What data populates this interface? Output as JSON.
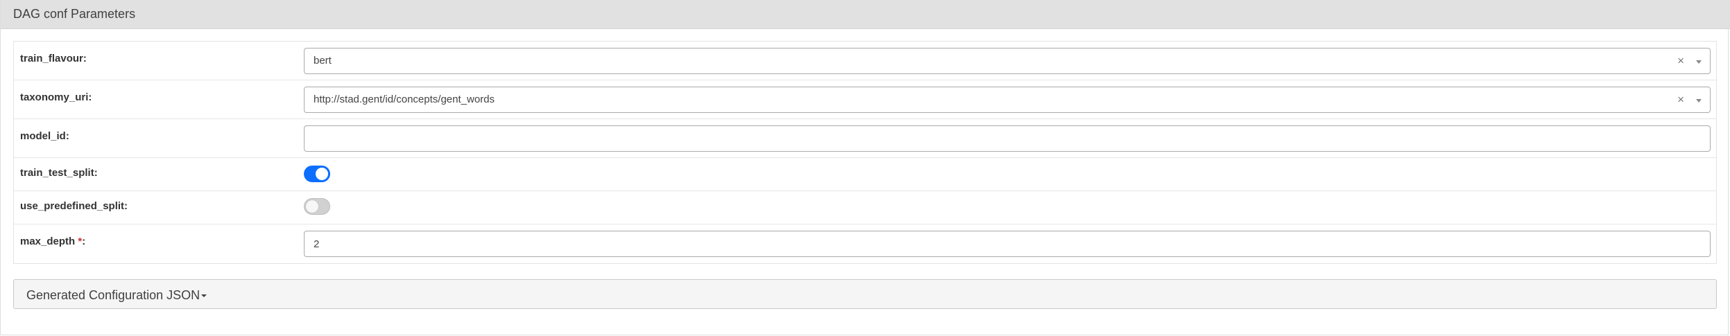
{
  "panel": {
    "title": "DAG conf Parameters"
  },
  "params": {
    "train_flavour": {
      "label": "train_flavour:",
      "value": "bert",
      "clear_glyph": "×"
    },
    "taxonomy_uri": {
      "label": "taxonomy_uri:",
      "value": "http://stad.gent/id/concepts/gent_words",
      "clear_glyph": "×"
    },
    "model_id": {
      "label": "model_id:",
      "value": ""
    },
    "train_test_split": {
      "label": "train_test_split:",
      "checked": true
    },
    "use_predefined_split": {
      "label": "use_predefined_split:",
      "checked": false
    },
    "max_depth": {
      "label_text": "max_depth ",
      "required_marker": "*",
      "label_suffix": ":",
      "value": "2"
    }
  },
  "generated_config": {
    "label": "Generated Configuration JSON"
  },
  "colors": {
    "heading_bg": "#e1e1e1",
    "toggle_on": "#0d6efd",
    "toggle_off": "#d1d1d1",
    "required": "#c9302c"
  },
  "icons": {
    "clear": "close-icon",
    "dropdown": "chevron-down-icon",
    "collapse_caret": "caret-down-icon"
  }
}
